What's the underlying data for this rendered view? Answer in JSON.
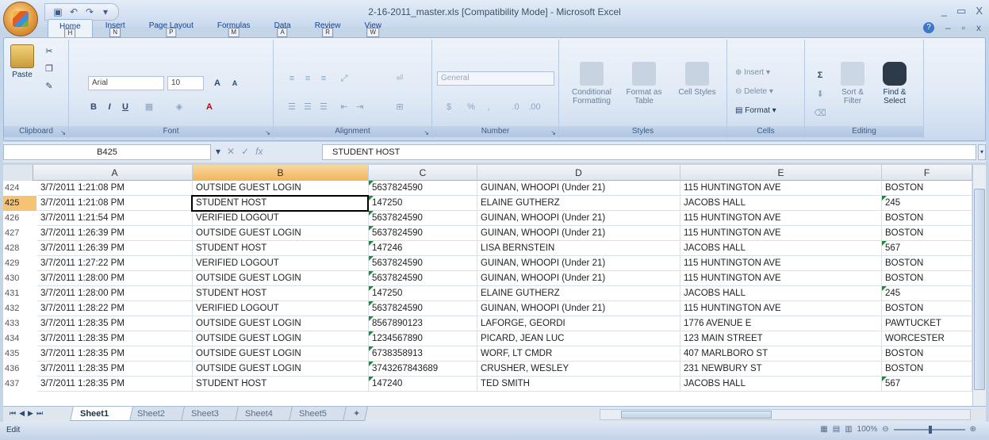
{
  "window": {
    "title": "2-16-2011_master.xls  [Compatibility Mode] - Microsoft Excel",
    "controls": [
      "_",
      "▭",
      "X"
    ]
  },
  "ribbon_tabs": [
    {
      "label": "Home",
      "key": "H",
      "active": true
    },
    {
      "label": "Insert",
      "key": "N"
    },
    {
      "label": "Page Layout",
      "key": "P"
    },
    {
      "label": "Formulas",
      "key": "M"
    },
    {
      "label": "Data",
      "key": "A"
    },
    {
      "label": "Review",
      "key": "R"
    },
    {
      "label": "View",
      "key": "W"
    }
  ],
  "ribbon": {
    "clipboard": {
      "label": "Clipboard",
      "paste": "Paste"
    },
    "font": {
      "label": "Font",
      "font_name": "Arial",
      "font_size": "10"
    },
    "alignment": {
      "label": "Alignment"
    },
    "number": {
      "label": "Number",
      "format": "General"
    },
    "styles": {
      "label": "Styles",
      "conditional": "Conditional Formatting",
      "format_table": "Format as Table",
      "cell_styles": "Cell Styles"
    },
    "cells": {
      "label": "Cells",
      "insert": "Insert",
      "delete": "Delete",
      "format": "Format"
    },
    "editing": {
      "label": "Editing",
      "sort": "Sort & Filter",
      "find": "Find & Select"
    }
  },
  "formula_bar": {
    "name_box": "B425",
    "formula": "STUDENT HOST"
  },
  "columns": [
    "A",
    "B",
    "C",
    "D",
    "E",
    "F"
  ],
  "rows": [
    {
      "n": "424",
      "a": "3/7/2011 1:21:08 PM",
      "b": "OUTSIDE GUEST LOGIN",
      "c": "5637824590",
      "d": "GUINAN, WHOOPI (Under 21)",
      "e": "115 HUNTINGTON AVE",
      "f": "BOSTON"
    },
    {
      "n": "425",
      "a": "3/7/2011 1:21:08 PM",
      "b": "STUDENT HOST",
      "c": "147250",
      "d": "ELAINE GUTHERZ",
      "e": "JACOBS HALL",
      "f": "245"
    },
    {
      "n": "426",
      "a": "3/7/2011 1:21:54 PM",
      "b": "VERIFIED LOGOUT",
      "c": "5637824590",
      "d": "GUINAN, WHOOPI (Under 21)",
      "e": "115 HUNTINGTON AVE",
      "f": "BOSTON"
    },
    {
      "n": "427",
      "a": "3/7/2011 1:26:39 PM",
      "b": "OUTSIDE GUEST LOGIN",
      "c": "5637824590",
      "d": "GUINAN, WHOOPI (Under 21)",
      "e": "115 HUNTINGTON AVE",
      "f": "BOSTON"
    },
    {
      "n": "428",
      "a": "3/7/2011 1:26:39 PM",
      "b": "STUDENT HOST",
      "c": "147246",
      "d": "LISA BERNSTEIN",
      "e": "JACOBS HALL",
      "f": "567"
    },
    {
      "n": "429",
      "a": "3/7/2011 1:27:22 PM",
      "b": "VERIFIED LOGOUT",
      "c": "5637824590",
      "d": "GUINAN, WHOOPI (Under 21)",
      "e": "115 HUNTINGTON AVE",
      "f": "BOSTON"
    },
    {
      "n": "430",
      "a": "3/7/2011 1:28:00 PM",
      "b": "OUTSIDE GUEST LOGIN",
      "c": "5637824590",
      "d": "GUINAN, WHOOPI (Under 21)",
      "e": "115 HUNTINGTON AVE",
      "f": "BOSTON"
    },
    {
      "n": "431",
      "a": "3/7/2011 1:28:00 PM",
      "b": "STUDENT HOST",
      "c": "147250",
      "d": "ELAINE GUTHERZ",
      "e": "JACOBS HALL",
      "f": "245"
    },
    {
      "n": "432",
      "a": "3/7/2011 1:28:22 PM",
      "b": "VERIFIED LOGOUT",
      "c": "5637824590",
      "d": "GUINAN, WHOOPI (Under 21)",
      "e": "115 HUNTINGTON AVE",
      "f": "BOSTON"
    },
    {
      "n": "433",
      "a": "3/7/2011 1:28:35 PM",
      "b": "OUTSIDE GUEST LOGIN",
      "c": "8567890123",
      "d": "LAFORGE, GEORDI",
      "e": "1776 AVENUE E",
      "f": "PAWTUCKET"
    },
    {
      "n": "434",
      "a": "3/7/2011 1:28:35 PM",
      "b": "OUTSIDE GUEST LOGIN",
      "c": "1234567890",
      "d": "PICARD, JEAN LUC",
      "e": "123 MAIN STREET",
      "f": "WORCESTER"
    },
    {
      "n": "435",
      "a": "3/7/2011 1:28:35 PM",
      "b": "OUTSIDE GUEST LOGIN",
      "c": "6738358913",
      "d": "WORF, LT CMDR",
      "e": "407 MARLBORO ST",
      "f": "BOSTON"
    },
    {
      "n": "436",
      "a": "3/7/2011 1:28:35 PM",
      "b": "OUTSIDE GUEST LOGIN",
      "c": "3743267843689",
      "d": "CRUSHER, WESLEY",
      "e": "231 NEWBURY ST",
      "f": "BOSTON"
    },
    {
      "n": "437",
      "a": "3/7/2011 1:28:35 PM",
      "b": "STUDENT HOST",
      "c": "147240",
      "d": "TED SMITH",
      "e": "JACOBS HALL",
      "f": "567"
    }
  ],
  "sheets": [
    "Sheet1",
    "Sheet2",
    "Sheet3",
    "Sheet4",
    "Sheet5"
  ],
  "status": {
    "mode": "Edit",
    "zoom": "100%"
  }
}
